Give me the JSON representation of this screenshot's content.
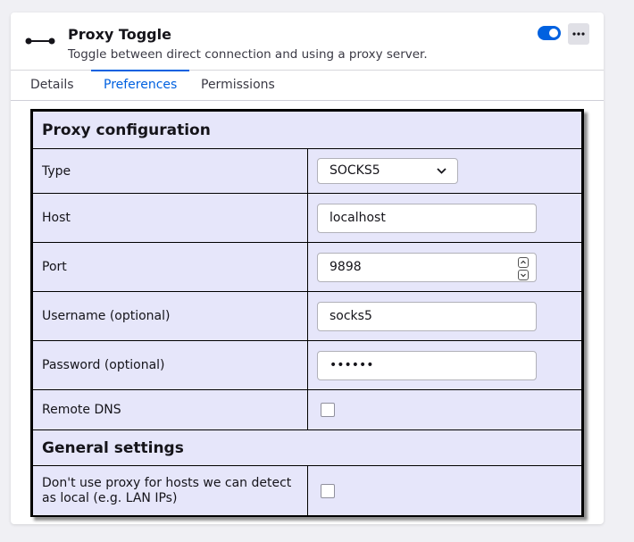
{
  "addon": {
    "name": "Proxy Toggle",
    "description": "Toggle between direct connection and using a proxy server.",
    "enabled": true,
    "icon": "proxy-connector-icon",
    "more_icon": "more-options-icon"
  },
  "tabs": [
    {
      "label": "Details",
      "active": false
    },
    {
      "label": "Preferences",
      "active": true
    },
    {
      "label": "Permissions",
      "active": false
    }
  ],
  "preferences": {
    "proxy_section_title": "Proxy configuration",
    "type": {
      "label": "Type",
      "value": "SOCKS5"
    },
    "host": {
      "label": "Host",
      "value": "localhost"
    },
    "port": {
      "label": "Port",
      "value": "9898"
    },
    "username": {
      "label": "Username (optional)",
      "value": "socks5"
    },
    "password": {
      "label": "Password (optional)",
      "value": "••••••"
    },
    "remote_dns": {
      "label": "Remote DNS",
      "checked": false
    },
    "general_section_title": "General settings",
    "no_proxy_local": {
      "label": "Don't use proxy for hosts we can detect as local (e.g. LAN IPs)",
      "checked": false
    }
  },
  "colors": {
    "accent": "#0061e0",
    "panel_background": "#e6e6fa"
  }
}
